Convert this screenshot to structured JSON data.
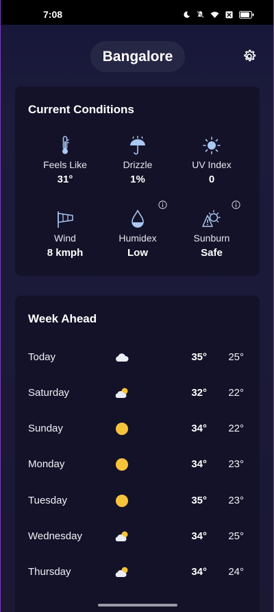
{
  "status_bar": {
    "time": "7:08"
  },
  "header": {
    "city": "Bangalore"
  },
  "current": {
    "title": "Current Conditions",
    "items": [
      {
        "icon": "thermometer-icon",
        "label": "Feels Like",
        "value": "31°"
      },
      {
        "icon": "umbrella-rain-icon",
        "label": "Drizzle",
        "value": "1%"
      },
      {
        "icon": "sun-icon",
        "label": "UV Index",
        "value": "0"
      },
      {
        "icon": "windsock-icon",
        "label": "Wind",
        "value": "8 kmph"
      },
      {
        "icon": "droplet-icon",
        "label": "Humidex",
        "value": "Low"
      },
      {
        "icon": "sunburn-warning-icon",
        "label": "Sunburn",
        "value": "Safe"
      }
    ]
  },
  "week": {
    "title": "Week Ahead",
    "days": [
      {
        "day": "Today",
        "icon": "cloud-icon",
        "hi": "35°",
        "lo": "25°"
      },
      {
        "day": "Saturday",
        "icon": "partly-cloudy-icon",
        "hi": "32°",
        "lo": "22°"
      },
      {
        "day": "Sunday",
        "icon": "sunny-icon",
        "hi": "34°",
        "lo": "22°"
      },
      {
        "day": "Monday",
        "icon": "sunny-icon",
        "hi": "34°",
        "lo": "23°"
      },
      {
        "day": "Tuesday",
        "icon": "sunny-icon",
        "hi": "35°",
        "lo": "23°"
      },
      {
        "day": "Wednesday",
        "icon": "partly-cloudy-icon",
        "hi": "34°",
        "lo": "25°"
      },
      {
        "day": "Thursday",
        "icon": "partly-cloudy-icon",
        "hi": "34°",
        "lo": "24°"
      }
    ]
  },
  "colors": {
    "accent_icon": "#a9c8f2",
    "sun": "#f7c33b",
    "card": "#141228",
    "background": "#1b1a33"
  }
}
